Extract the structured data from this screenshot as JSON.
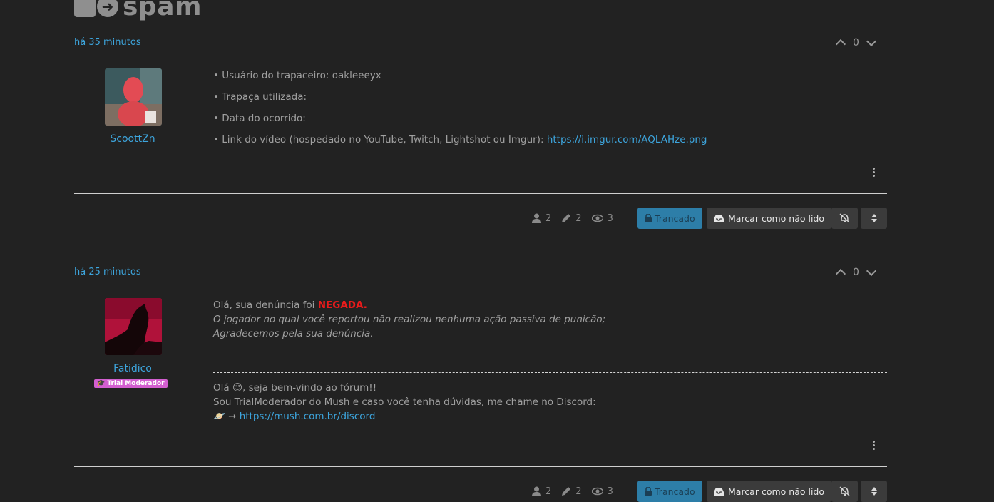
{
  "header": {
    "logo_text": "spam"
  },
  "posts": [
    {
      "timestamp": "há 35 minutos",
      "votes": "0",
      "author": "ScoottZn",
      "lines": [
        "• Usuário do trapaceiro: oakleeeyx",
        "• Trapaça utilizada:",
        "• Data do ocorrido:",
        "• Link do vídeo (hospedado no YouTube, Twitch, Lightshot ou Imgur): "
      ],
      "link": "https://i.imgur.com/AQLAHze.png"
    },
    {
      "timestamp": "há 25 minutos",
      "votes": "0",
      "author": "Fatidico",
      "badge": "🎓 Trial Moderador",
      "intro": "Olá, sua denúncia foi ",
      "verdict": "NEGADA.",
      "italic_1": "O jogador no qual você reportou não realizou nenhuma ação passiva de punição;",
      "italic_2": "Agradecemos pela sua denúncia.",
      "sig_1": "Olá 😉, seja bem-vindo ao fórum!!",
      "sig_2": "Sou TrialModerador do Mush e caso você tenha dúvidas, me chame no Discord:",
      "sig_3_prefix": "🪐 ➞ ",
      "sig_link": "https://mush.com.br/discord"
    }
  ],
  "topic_bar": {
    "posters": "2",
    "posts": "2",
    "views": "3",
    "locked_label": "Trancado",
    "mark_unread_label": "Marcar como não lido"
  },
  "icons": [
    "lock-icon",
    "arrow-circle-icon",
    "chevron-up-icon",
    "chevron-down-icon",
    "kebab-menu-icon",
    "user-icon",
    "pencil-icon",
    "eye-icon",
    "inbox-icon",
    "bell-slash-icon",
    "sort-icon"
  ],
  "colors": {
    "background": "#222222",
    "link": "#3da5dd",
    "locked_button": "#2d7ea8",
    "negada": "#e81b1b",
    "badge": "#d35fd0"
  }
}
